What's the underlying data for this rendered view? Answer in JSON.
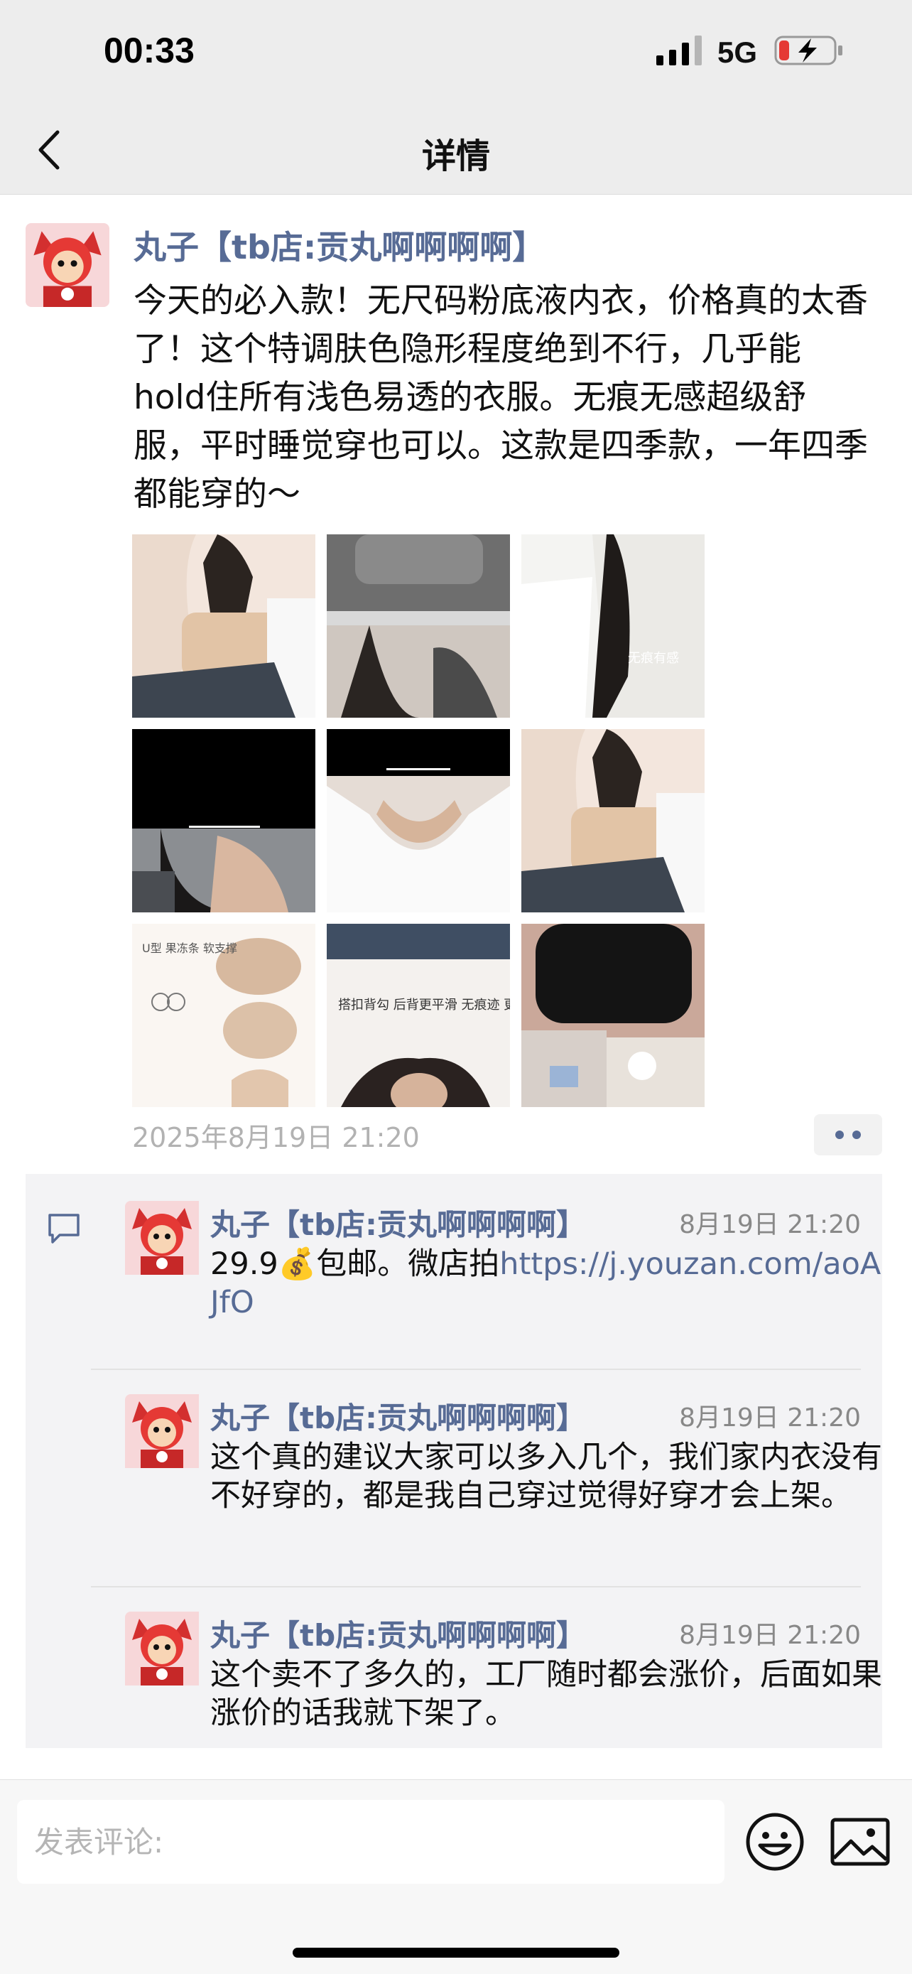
{
  "status_bar": {
    "time": "00:33",
    "network": "5G",
    "battery_level": 0.15
  },
  "nav": {
    "title": "详情",
    "back_icon": "chevron-left-icon"
  },
  "post": {
    "author": "丸子【tb店:贡丸啊啊啊啊】",
    "text": "今天的必入款！无尺码粉底液内衣，价格真的太香了！这个特调肤色隐形程度绝到不行，几乎能hold住所有浅色易透的衣服。无痕无感超级舒服，平时睡觉穿也可以。这款是四季款，一年四季都能穿的～",
    "timestamp": "2025年8月19日 21:20",
    "photos": [
      {
        "overlay_text": ""
      },
      {
        "overlay_text": ""
      },
      {
        "overlay_text": "无痕有感"
      },
      {
        "overlay_text": ""
      },
      {
        "overlay_text": ""
      },
      {
        "overlay_text": ""
      },
      {
        "overlay_text": "U型 果冻条 软支撑"
      },
      {
        "overlay_text": "搭扣背勾 后背更平滑 无痕迹 更透气"
      },
      {
        "overlay_text": ""
      }
    ]
  },
  "comments": [
    {
      "author": "丸子【tb店:贡丸啊啊啊啊】",
      "time": "8月19日 21:20",
      "text": "29.9💰包邮。微店拍",
      "link": "https://j.youzan.com/aoAJfO"
    },
    {
      "author": "丸子【tb店:贡丸啊啊啊啊】",
      "time": "8月19日 21:20",
      "text": "这个真的建议大家可以多入几个，我们家内衣没有不好穿的，都是我自己穿过觉得好穿才会上架。"
    },
    {
      "author": "丸子【tb店:贡丸啊啊啊啊】",
      "time": "8月19日 21:20",
      "text": "这个卖不了多久的，工厂随时都会涨价，后面如果涨价的话我就下架了。"
    }
  ],
  "input": {
    "placeholder": "发表评论:"
  },
  "colors": {
    "link": "#576b95",
    "background": "#ededed",
    "comment_bg": "#f3f3f5"
  }
}
